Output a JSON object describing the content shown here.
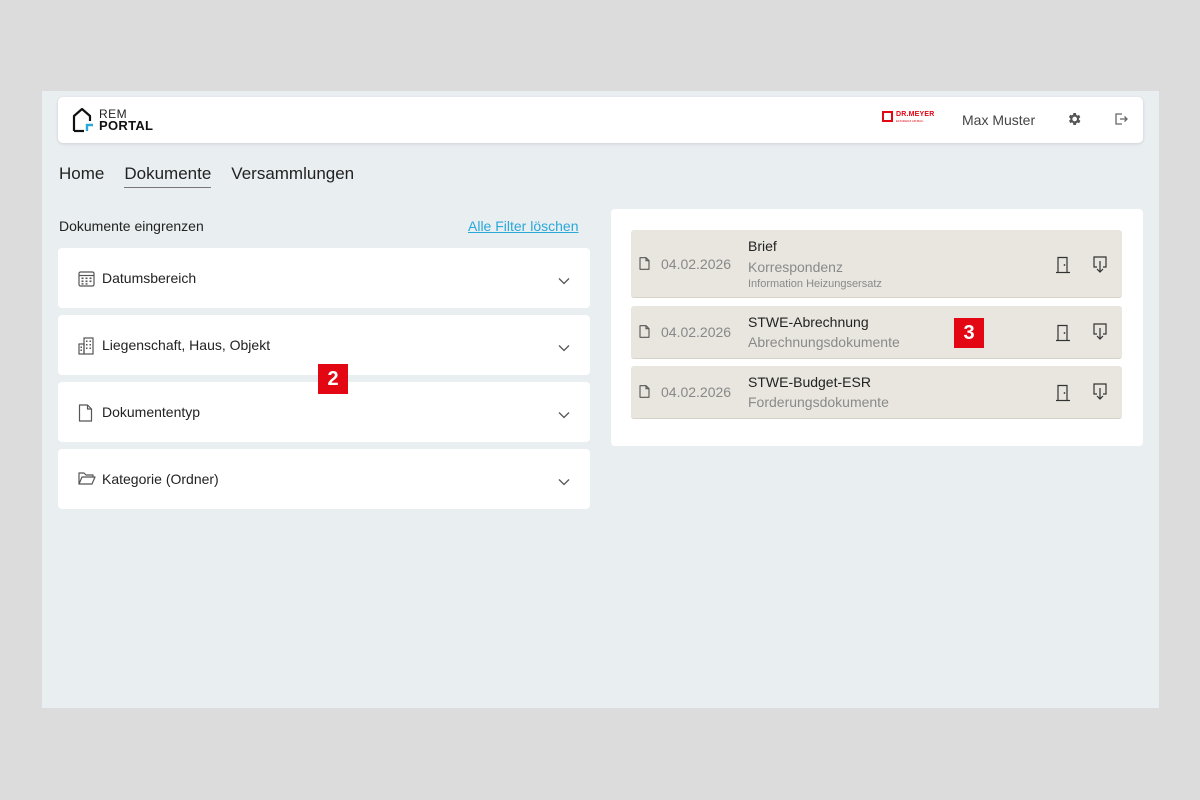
{
  "header": {
    "logo_line1": "REM",
    "logo_line2": "PORTAL",
    "brand_name": "DR.MEYER",
    "brand_sub": "EFFIZIENZ AM BAU",
    "user_name": "Max Muster"
  },
  "nav": {
    "tabs": [
      {
        "label": "Home",
        "active": false
      },
      {
        "label": "Dokumente",
        "active": true
      },
      {
        "label": "Versammlungen",
        "active": false
      }
    ]
  },
  "filters": {
    "title": "Dokumente eingrenzen",
    "clear_label": "Alle Filter löschen",
    "items": [
      {
        "label": "Datumsbereich",
        "icon": "calendar-icon"
      },
      {
        "label": "Liegenschaft, Haus, Objekt",
        "icon": "building-icon"
      },
      {
        "label": "Dokumententyp",
        "icon": "document-icon"
      },
      {
        "label": "Kategorie (Ordner)",
        "icon": "folder-icon"
      }
    ]
  },
  "documents": [
    {
      "date": "04.02.2026",
      "title": "Brief",
      "category": "Korrespondenz",
      "note": "Information Heizungsersatz"
    },
    {
      "date": "04.02.2026",
      "title": "STWE-Abrechnung",
      "category": "Abrechnungsdokumente"
    },
    {
      "date": "04.02.2026",
      "title": "STWE-Budget-ESR",
      "category": "Forderungsdokumente"
    }
  ],
  "badges": {
    "left": "2",
    "right": "3"
  },
  "colors": {
    "accent": "#2aa8d8",
    "brand_red": "#e30613",
    "background": "#e9eef1",
    "doc_row": "#e8e6df"
  }
}
